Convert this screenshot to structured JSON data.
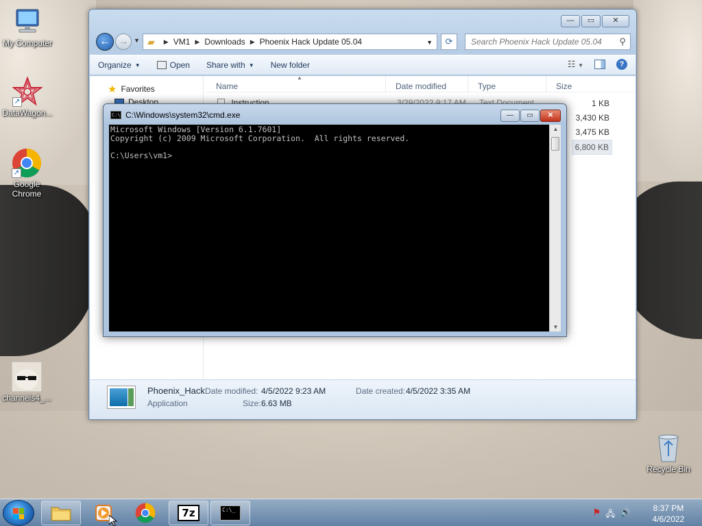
{
  "desktop": {
    "icons": [
      {
        "label": "My Computer"
      },
      {
        "label": "DataWagon..."
      },
      {
        "label": "Google Chrome"
      },
      {
        "label": "channels4_..."
      },
      {
        "label": "Recycle Bin"
      }
    ]
  },
  "explorer": {
    "breadcrumb": [
      "VM1",
      "Downloads",
      "Phoenix Hack Update 05.04"
    ],
    "search_placeholder": "Search Phoenix Hack Update 05.04",
    "toolbar": {
      "organize": "Organize",
      "open": "Open",
      "share_with": "Share with",
      "new_folder": "New folder"
    },
    "nav": {
      "favorites": "Favorites",
      "desktop": "Desktop"
    },
    "columns": {
      "name": "Name",
      "date_modified": "Date modified",
      "type": "Type",
      "size": "Size"
    },
    "files": [
      {
        "name": "Instruction",
        "date": "3/29/2022 9:17 AM",
        "type": "Text Document",
        "size": "1 KB"
      },
      {
        "size": "3,430 KB"
      },
      {
        "size": "3,475 KB"
      },
      {
        "size": "6,800 KB"
      }
    ],
    "details": {
      "name": "Phoenix_Hack",
      "kind": "Application",
      "date_modified_label": "Date modified:",
      "date_modified": "4/5/2022 9:23 AM",
      "date_created_label": "Date created:",
      "date_created": "4/5/2022 3:35 AM",
      "size_label": "Size:",
      "size": "6.63 MB"
    }
  },
  "cmd": {
    "title": "C:\\Windows\\system32\\cmd.exe",
    "lines": [
      "Microsoft Windows [Version 6.1.7601]",
      "Copyright (c) 2009 Microsoft Corporation.  All rights reserved.",
      "",
      "C:\\Users\\vm1>"
    ]
  },
  "taskbar": {
    "time": "8:37 PM",
    "date": "4/6/2022",
    "sevenzip_label": "7z"
  }
}
